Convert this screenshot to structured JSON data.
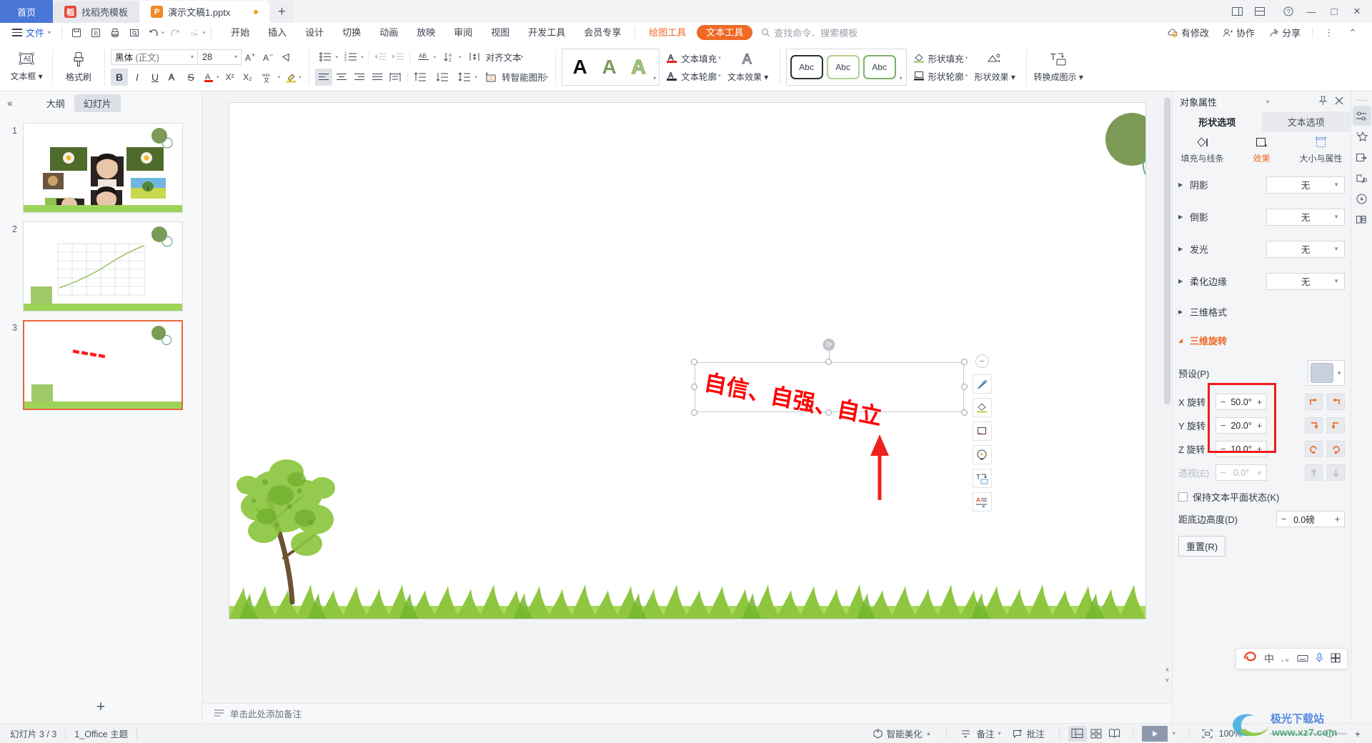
{
  "titlebar": {
    "tabs": [
      {
        "label": "首页",
        "kind": "home"
      },
      {
        "label": "找稻壳模板",
        "kind": "inactive",
        "icon": "daoke-icon"
      },
      {
        "label": "演示文稿1.pptx",
        "kind": "active",
        "icon": "wpp-icon"
      }
    ],
    "new_tab": "+",
    "window_buttons": {
      "minimize": "—",
      "maximize": "□",
      "close": "✕"
    }
  },
  "menubar": {
    "file": "文件",
    "quick_access": [
      "save-icon",
      "save-as-icon",
      "print-icon",
      "print-preview-icon",
      "undo-icon",
      "redo-icon",
      "format-painter-icon",
      "customize-icon"
    ],
    "items": [
      "开始",
      "插入",
      "设计",
      "切换",
      "动画",
      "放映",
      "审阅",
      "视图",
      "开发工具",
      "会员专享"
    ],
    "context_tabs": [
      {
        "label": "绘图工具",
        "style": "orange-text"
      },
      {
        "label": "文本工具",
        "style": "orange-pill"
      }
    ],
    "search_placeholder": "查找命令、搜索模板",
    "right": [
      {
        "label": "有修改",
        "icon": "cloud-sync-icon"
      },
      {
        "label": "协作",
        "icon": "collaborate-icon"
      },
      {
        "label": "分享",
        "icon": "share-icon"
      }
    ]
  },
  "ribbon": {
    "textbox_button": "文本框",
    "format_painter": "格式刷",
    "font_name": "黑体",
    "font_name_suffix": " (正文)",
    "font_size": "28",
    "font_buttons": {
      "grow": "A+",
      "shrink": "A-",
      "clear_format": "clear-format-icon",
      "bold": "B",
      "italic": "I",
      "underline": "U",
      "shadow": "A",
      "strike": "S",
      "font_color": "font-color-icon",
      "superscript": "X²",
      "subscript": "X₂",
      "char_style": "char-style-icon",
      "highlight": "highlight-icon"
    },
    "paragraph_buttons": {
      "bullets": "bullet-list-icon",
      "numbering": "numbered-list-icon",
      "decrease_indent": "decrease-indent-icon",
      "increase_indent": "increase-indent-icon",
      "text_direction": "text-direction-icon",
      "sort": "sort-icon",
      "align_left": "align-left-icon",
      "align_center": "align-center-icon",
      "align_right": "align-right-icon",
      "justify": "justify-icon",
      "distribute": "distribute-icon",
      "space_before": "space-before-icon",
      "space_after": "space-after-icon",
      "line_spacing": "line-spacing-icon"
    },
    "align_text": "对齐文本",
    "to_smartart": "转智能图形",
    "wordart_styles": [
      "A",
      "A",
      "A"
    ],
    "text_fill": "文本填充",
    "text_outline": "文本轮廓",
    "text_effects": "文本效果",
    "shape_styles": [
      "Abc",
      "Abc",
      "Abc"
    ],
    "shape_fill": "形状填充",
    "shape_outline": "形状轮廓",
    "shape_effects": "形状效果",
    "convert_to_diagram": "转换成图示"
  },
  "thumbnails": {
    "collapse_icon": "collapse-left-icon",
    "tabs": [
      {
        "label": "大纲",
        "active": false
      },
      {
        "label": "幻灯片",
        "active": true
      }
    ],
    "slides": [
      {
        "number": "1",
        "selected": false,
        "kind": "photos"
      },
      {
        "number": "2",
        "selected": false,
        "kind": "chart"
      },
      {
        "number": "3",
        "selected": true,
        "kind": "text"
      }
    ],
    "add_slide": "+"
  },
  "slide": {
    "text_box": {
      "content": "自信、自强、自立",
      "color": "#ff0000",
      "font": "黑体",
      "size": "28"
    },
    "decorations": [
      "green-circle",
      "green-ring",
      "tree",
      "grass-strip"
    ],
    "annotation_arrow": "red-arrow-annotation"
  },
  "float_toolbar": {
    "collapse": "−",
    "buttons": [
      "format-brush-icon",
      "fill-color-icon",
      "shape-outline-icon",
      "quick-style-icon",
      "convert-diagram-icon",
      "text-layout-icon"
    ]
  },
  "notes": {
    "icon": "notes-icon",
    "placeholder": "单击此处添加备注"
  },
  "properties_panel": {
    "title": "对象属性",
    "pin_icon": "pin-icon",
    "close_icon": "close-icon",
    "tabs": [
      {
        "label": "形状选项",
        "active": true
      },
      {
        "label": "文本选项",
        "active": false
      }
    ],
    "subtabs": [
      {
        "label": "填充与线条",
        "active": false,
        "icon": "fill-line-icon"
      },
      {
        "label": "效果",
        "active": true,
        "icon": "effects-icon"
      },
      {
        "label": "大小与属性",
        "active": false,
        "icon": "size-props-icon"
      }
    ],
    "effects": [
      {
        "label": "阴影",
        "value": "无",
        "expanded": false
      },
      {
        "label": "倒影",
        "value": "无",
        "expanded": false
      },
      {
        "label": "发光",
        "value": "无",
        "expanded": false
      },
      {
        "label": "柔化边缘",
        "value": "无",
        "expanded": false
      }
    ],
    "format3d_label": "三维格式",
    "rotation3d": {
      "label": "三维旋转",
      "preset_label": "预设(P)",
      "rows": [
        {
          "label": "X 旋转",
          "value": "50.0°",
          "minus": "−",
          "plus": "+"
        },
        {
          "label": "Y 旋转",
          "value": "20.0°",
          "minus": "−",
          "plus": "+"
        },
        {
          "label": "Z 旋转",
          "value": "10.0°",
          "minus": "−",
          "plus": "+"
        }
      ],
      "perspective": {
        "label": "透视(E)",
        "value": "0.0°",
        "minus": "−",
        "plus": "+"
      },
      "keep_flat": "保持文本平面状态(K)",
      "distance": {
        "label": "距底边高度(D)",
        "value": "0.0磅",
        "minus": "−",
        "plus": "+"
      },
      "reset": "重置(R)",
      "highlight_color": "#f01c1c"
    }
  },
  "icon_strip": [
    {
      "name": "properties-icon",
      "active": true
    },
    {
      "name": "effects-star-icon",
      "active": false
    },
    {
      "name": "transition-icon",
      "active": false
    },
    {
      "name": "design-ideas-icon",
      "active": false
    },
    {
      "name": "quick-action-icon",
      "active": false
    },
    {
      "name": "resource-library-icon",
      "active": false
    }
  ],
  "statusbar": {
    "slide_count": "幻灯片 3 / 3",
    "theme": "1_Office 主题",
    "beautify": "智能美化",
    "notes_btn": "备注",
    "comments_btn": "批注",
    "view_buttons": [
      "normal-view-icon",
      "slide-sorter-icon",
      "reading-view-icon"
    ],
    "play": "play-icon",
    "fit_icon": "fit-slide-icon",
    "zoom": "100%",
    "zoom_out": "−",
    "zoom_in": "+"
  },
  "ime": {
    "logo": "sogou-icon",
    "mode": "中",
    "items": [
      "comma-icon",
      "keyboard-icon",
      "mic-icon",
      "panel-icon"
    ]
  },
  "watermark": {
    "title": "极光下载站",
    "url": "www.xz7.com"
  }
}
